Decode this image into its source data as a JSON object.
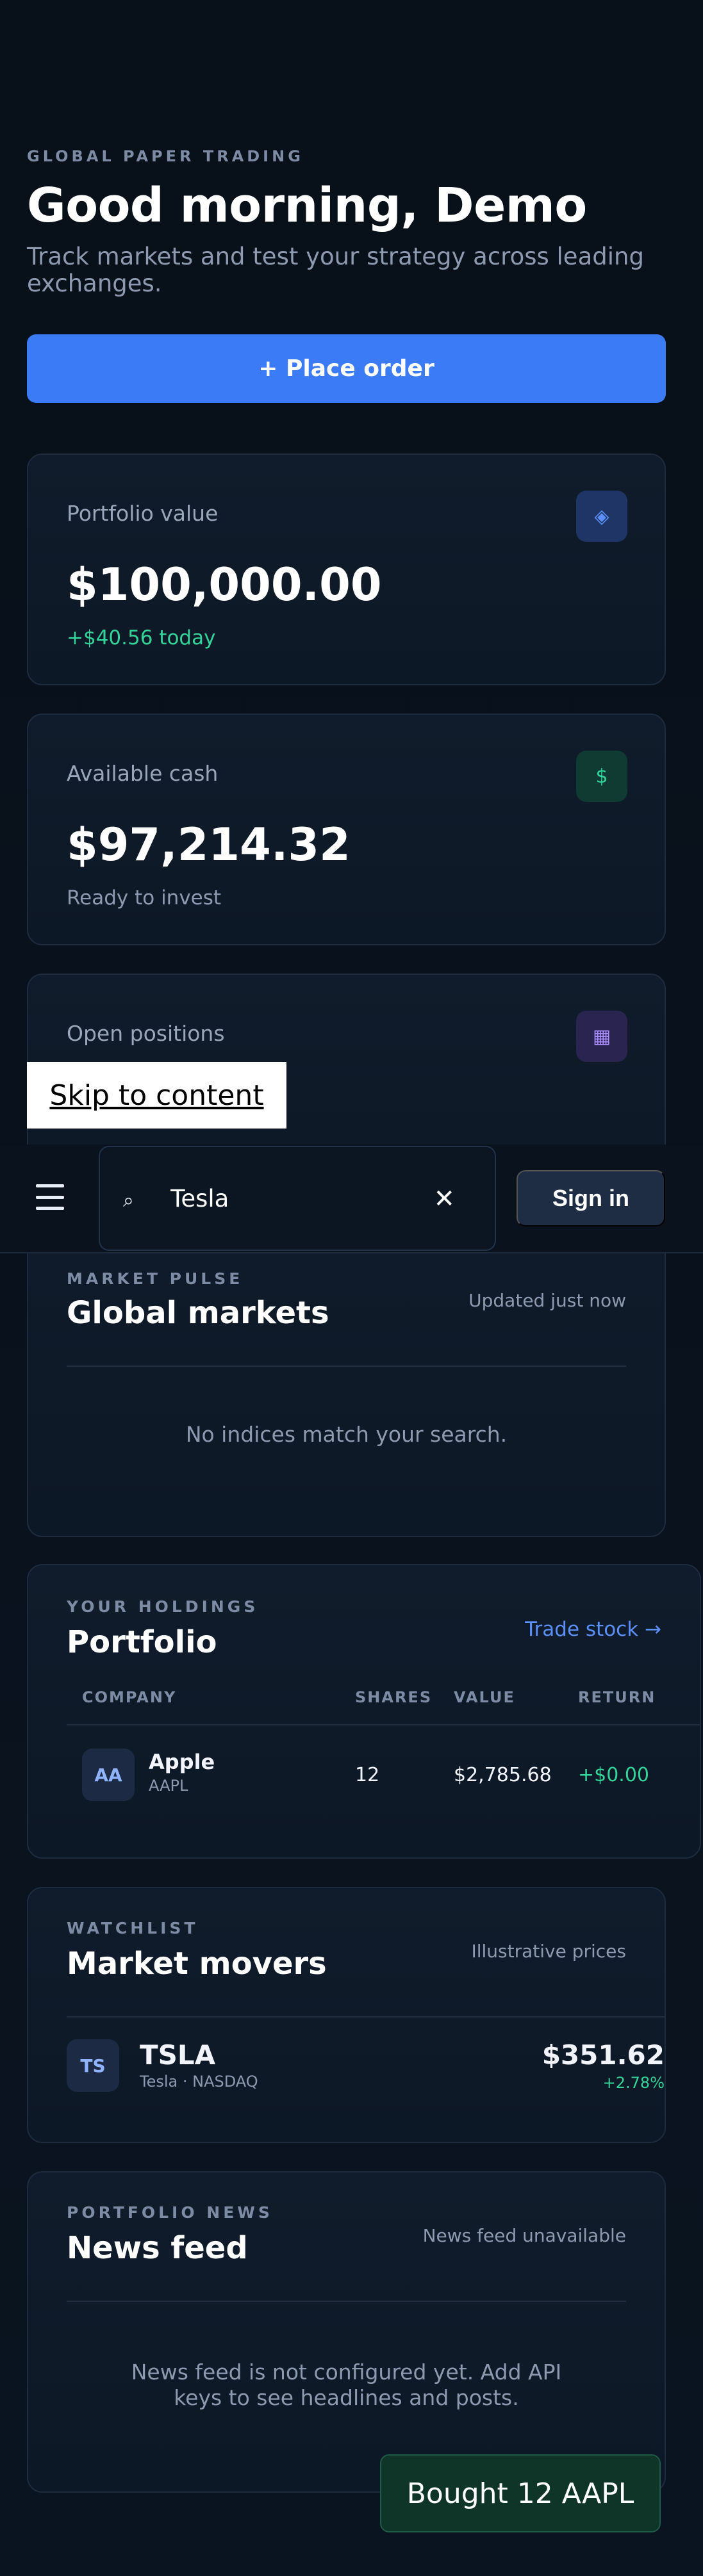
{
  "hero": {
    "eyebrow": "GLOBAL PAPER TRADING",
    "title": "Good morning, Demo",
    "subtitle": "Track markets and test your strategy across leading exchanges.",
    "place_order_label": "+ Place order"
  },
  "stats": [
    {
      "label": "Portfolio value",
      "value": "$100,000.00",
      "sub": "+$40.56 today",
      "icon": "diamond-icon",
      "icon_glyph": "◈"
    },
    {
      "label": "Available cash",
      "value": "$97,214.32",
      "sub": "Ready to invest",
      "icon": "dollar-icon",
      "icon_glyph": "$"
    },
    {
      "label": "Open positions",
      "icon": "grid-icon",
      "icon_glyph": "▦"
    }
  ],
  "skip_link": "Skip to content",
  "topbar": {
    "search_value": "Tesla",
    "search_icon": "⌕",
    "clear_icon": "✕",
    "signin_label": "Sign in"
  },
  "markets": {
    "eyebrow": "MARKET PULSE",
    "title": "Global markets",
    "meta": "Updated just now",
    "empty": "No indices match your search."
  },
  "portfolio": {
    "eyebrow": "YOUR HOLDINGS",
    "title": "Portfolio",
    "link": "Trade stock →",
    "columns": [
      "COMPANY",
      "SHARES",
      "VALUE",
      "RETURN"
    ],
    "rows": [
      {
        "initials": "AA",
        "name": "Apple",
        "ticker": "AAPL",
        "shares": "12",
        "value": "$2,785.68",
        "return": "+$0.00"
      }
    ]
  },
  "watchlist": {
    "eyebrow": "WATCHLIST",
    "title": "Market movers",
    "meta": "Illustrative prices",
    "items": [
      {
        "initials": "TS",
        "symbol": "TSLA",
        "desc": "Tesla · NASDAQ",
        "price": "$351.62",
        "change": "+2.78%"
      }
    ]
  },
  "news": {
    "eyebrow": "PORTFOLIO NEWS",
    "title": "News feed",
    "meta": "News feed unavailable",
    "empty": "News feed is not configured yet. Add API keys to see headlines and posts."
  },
  "toast": "Bought 12 AAPL",
  "colors": {
    "accent": "#3b7bf6",
    "positive": "#34d399",
    "background": "#081019"
  }
}
